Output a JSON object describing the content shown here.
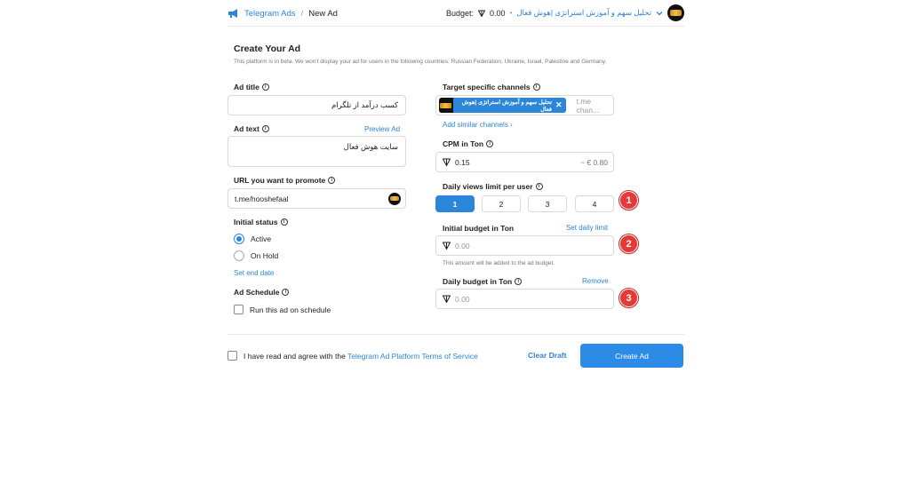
{
  "header": {
    "brand": "Telegram Ads",
    "separator": "/",
    "crumb": "New Ad",
    "budget_label": "Budget:",
    "budget_value": "0.00",
    "dot": "•",
    "channel": "تحلیل سهم و آموزش استراتژی |هوش فعال"
  },
  "page": {
    "title": "Create Your Ad",
    "subtitle": "This platform is in beta. We won't display your ad for users in the following countries: Russian Federation, Ukraine, Israel, Palestine and Germany."
  },
  "left": {
    "ad_title_label": "Ad title",
    "ad_title_value": "کسب درآمد از تلگرام",
    "ad_text_label": "Ad text",
    "preview_link": "Preview Ad",
    "ad_text_value": "سایت هوش فعال",
    "url_label": "URL you want to promote",
    "url_value": "t.me/hooshefaal",
    "status_label": "Initial status",
    "status_active": "Active",
    "status_hold": "On Hold",
    "end_date_link": "Set end date",
    "schedule_label": "Ad Schedule",
    "schedule_option": "Run this ad on schedule"
  },
  "right": {
    "target_label": "Target specific channels",
    "tag_text": "تحلیل سهم و آموزش استراتژی |هوش فعال",
    "tag_close": "✕",
    "target_placeholder": "t.me chan...",
    "similar_link": "Add similar channels",
    "cpm_label": "CPM in Ton",
    "cpm_value": "0.15",
    "cpm_eur": "~ € 0.80",
    "views_label": "Daily views limit per user",
    "views_options": [
      "1",
      "2",
      "3",
      "4"
    ],
    "initial_budget_label": "Initial budget in Ton",
    "set_daily_link": "Set daily limit",
    "initial_budget_placeholder": "0.00",
    "budget_note": "This amount will be added to the ad budget.",
    "daily_budget_label": "Daily budget in Ton",
    "remove_link": "Remove",
    "daily_budget_placeholder": "0.00"
  },
  "footer": {
    "agree_prefix": "I have read and agree with the",
    "terms_link": "Telegram Ad Platform Terms of Service",
    "clear_draft": "Clear Draft",
    "create_ad": "Create Ad"
  },
  "markers": [
    "1",
    "2",
    "3"
  ],
  "colors": {
    "accent": "#2b86d9",
    "primary_button": "#2b8be6",
    "marker": "#e53935"
  }
}
